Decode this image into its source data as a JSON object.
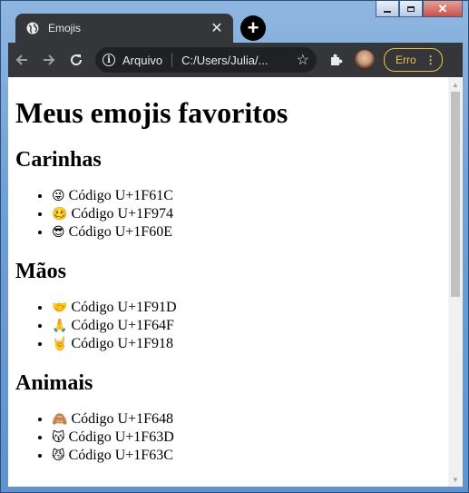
{
  "browser": {
    "tab_title": "Emojis",
    "tab_close": "✕",
    "new_tab": "+",
    "omnibox": {
      "scheme_label": "Arquivo",
      "url": "C:/Users/Julia/..."
    },
    "error_label": "Erro"
  },
  "page": {
    "title": "Meus emojis favoritos",
    "sections": [
      {
        "heading": "Carinhas",
        "items": [
          {
            "emoji": "😜",
            "text": "Código U+1F61C"
          },
          {
            "emoji": "🥴",
            "text": "Código U+1F974"
          },
          {
            "emoji": "😎",
            "text": "Código U+1F60E"
          }
        ]
      },
      {
        "heading": "Mãos",
        "items": [
          {
            "emoji": "🤝",
            "text": "Código U+1F91D"
          },
          {
            "emoji": "🙏",
            "text": "Código U+1F64F"
          },
          {
            "emoji": "🤘",
            "text": "Código U+1F918"
          }
        ]
      },
      {
        "heading": "Animais",
        "items": [
          {
            "emoji": "🙈",
            "text": "Código U+1F648"
          },
          {
            "emoji": "😽",
            "text": "Código U+1F63D"
          },
          {
            "emoji": "😼",
            "text": "Código U+1F63C"
          }
        ]
      }
    ]
  }
}
